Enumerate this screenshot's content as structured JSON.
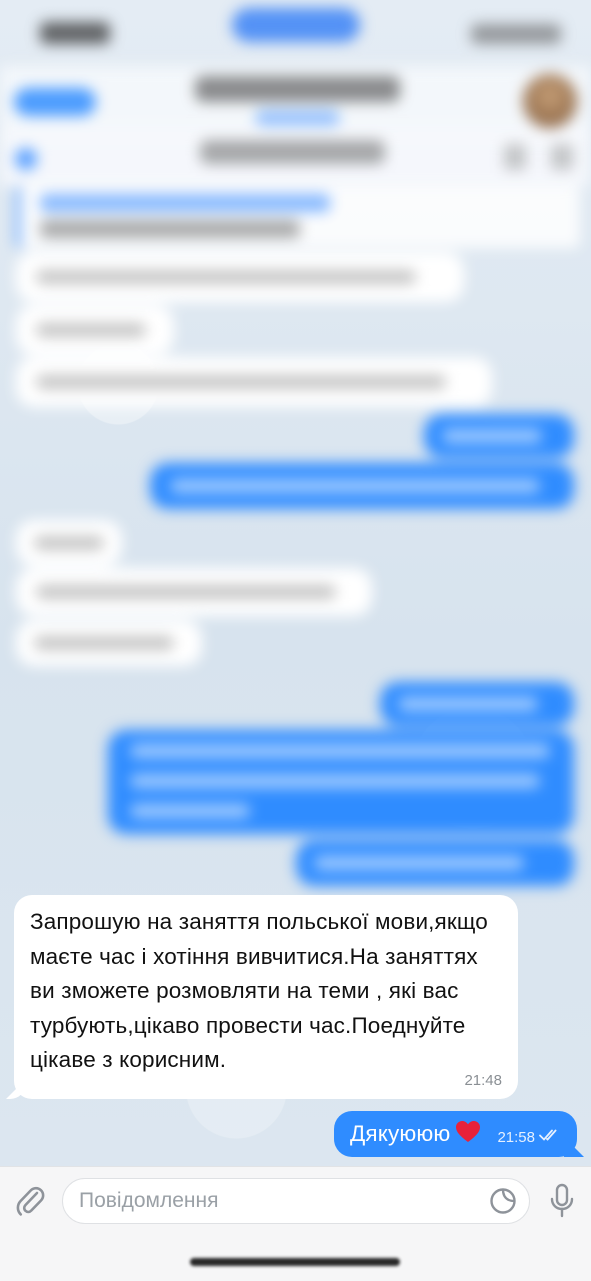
{
  "incoming_message": {
    "text": "Запрошую на заняття польської мови,якщо маєте час і хотіння вивчитися.На заняттях ви зможете розмовляти на теми , які вас турбують,цікаво провести час.Поеднуйте цікаве з корисним.",
    "time": "21:48"
  },
  "outgoing_message": {
    "text": "Дякуююю",
    "time": "21:58",
    "status": "read"
  },
  "input": {
    "placeholder": "Повідомлення",
    "value": ""
  },
  "icons": {
    "attach": "paperclip-icon",
    "sticker": "sticker-icon",
    "mic": "microphone-icon",
    "read_receipt": "double-check-icon",
    "heart": "red-heart-icon"
  },
  "colors": {
    "outgoing_bubble": "#2f8cff",
    "incoming_bubble": "#ffffff",
    "heart": "#e8213a"
  }
}
